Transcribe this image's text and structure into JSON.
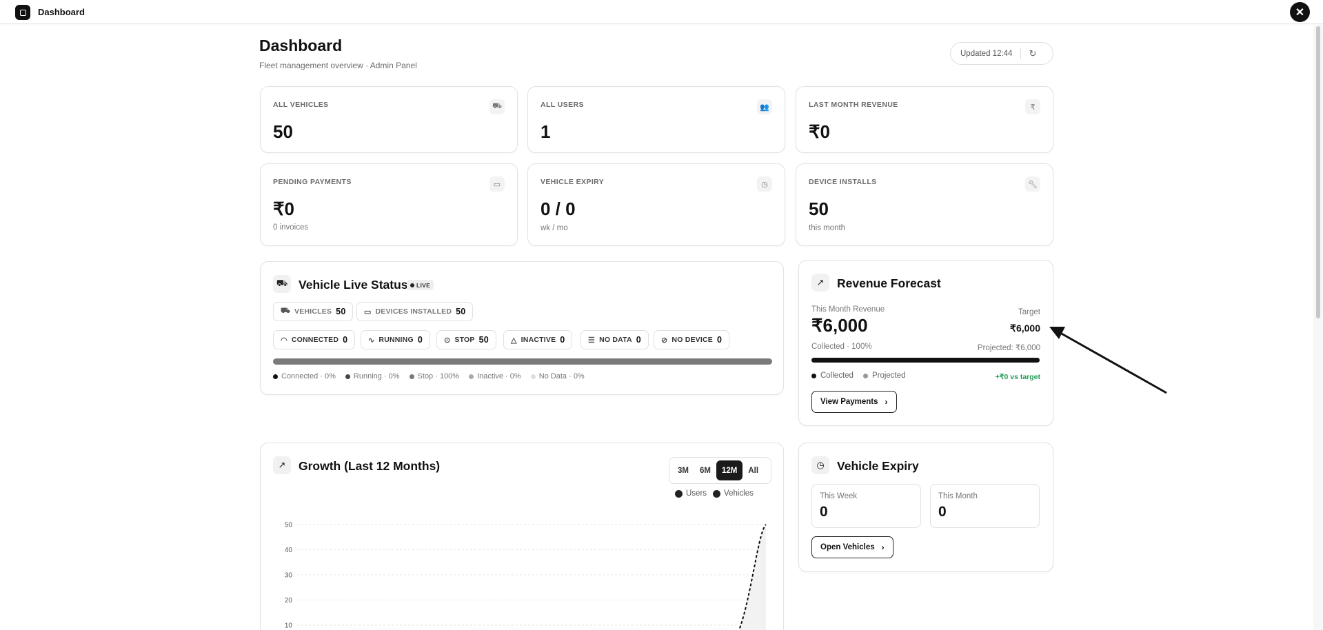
{
  "topbar": {
    "title": "Dashboard",
    "close_symbol": "✕"
  },
  "header": {
    "title": "Dashboard",
    "subtitle": "Fleet management overview · Admin Panel",
    "updated": "Updated 12:44"
  },
  "stats": {
    "all_vehicles": {
      "label": "ALL VEHICLES",
      "value": "50",
      "icon": "car-icon"
    },
    "all_users": {
      "label": "ALL USERS",
      "value": "1",
      "icon": "users-icon"
    },
    "last_month_revenue": {
      "label": "LAST MONTH REVENUE",
      "value": "₹0",
      "icon": "rupee-icon"
    },
    "pending_payments": {
      "label": "PENDING PAYMENTS",
      "value": "₹0",
      "sub": "0 invoices",
      "icon": "credit-card-icon"
    },
    "vehicle_expiry": {
      "label": "VEHICLE EXPIRY",
      "value": "0 / 0",
      "sub": "wk / mo",
      "icon": "calendar-clock-icon"
    },
    "device_installs": {
      "label": "DEVICE INSTALLS",
      "value": "50",
      "sub": "this month",
      "icon": "wrench-icon"
    }
  },
  "live_status": {
    "title": "Vehicle Live Status",
    "badge": "LIVE",
    "top_chips": [
      {
        "label": "VEHICLES",
        "count": "50"
      },
      {
        "label": "DEVICES INSTALLED",
        "count": "50"
      }
    ],
    "status_chips": [
      {
        "label": "CONNECTED",
        "count": "0"
      },
      {
        "label": "RUNNING",
        "count": "0"
      },
      {
        "label": "STOP",
        "count": "50"
      },
      {
        "label": "INACTIVE",
        "count": "0"
      },
      {
        "label": "NO DATA",
        "count": "0"
      },
      {
        "label": "NO DEVICE",
        "count": "0"
      }
    ],
    "legend": [
      "Connected · 0%",
      "Running · 0%",
      "Stop · 100%",
      "Inactive · 0%",
      "No Data · 0%"
    ],
    "stop_fraction": 1.0
  },
  "revenue_forecast": {
    "title": "Revenue Forecast",
    "this_month_label": "This Month Revenue",
    "this_month_value": "₹6,000",
    "target_label": "Target",
    "target_value": "₹6,000",
    "collected_text": "Collected · 100%",
    "projected_text": "Projected: ₹6,000",
    "collected_fraction": 1.0,
    "legend_collected": "Collected",
    "legend_projected": "Projected",
    "delta": "+₹0 vs target",
    "button": "View Payments"
  },
  "growth": {
    "title": "Growth (Last 12 Months)",
    "ranges": [
      "3M",
      "6M",
      "12M",
      "All"
    ],
    "active_range": "12M",
    "legend": [
      "Users",
      "Vehicles"
    ]
  },
  "vehicle_expiry_card": {
    "title": "Vehicle Expiry",
    "this_week_label": "This Week",
    "this_week_value": "0",
    "this_month_label": "This Month",
    "this_month_value": "0",
    "button": "Open Vehicles"
  },
  "chart_data": {
    "type": "line",
    "title": "Growth (Last 12 Months)",
    "xlabel": "",
    "ylabel": "",
    "ylim": [
      0,
      50
    ],
    "yticks": [
      10,
      20,
      30,
      40,
      50
    ],
    "grid": true,
    "legend_placement": "top-right",
    "series": [
      {
        "name": "Users",
        "values": [
          0,
          0,
          0,
          0,
          0,
          0,
          0,
          0,
          0,
          0,
          0,
          1
        ]
      },
      {
        "name": "Vehicles",
        "values": [
          0,
          0,
          0,
          0,
          0,
          0,
          0,
          0,
          0,
          0,
          0,
          50
        ]
      }
    ]
  }
}
